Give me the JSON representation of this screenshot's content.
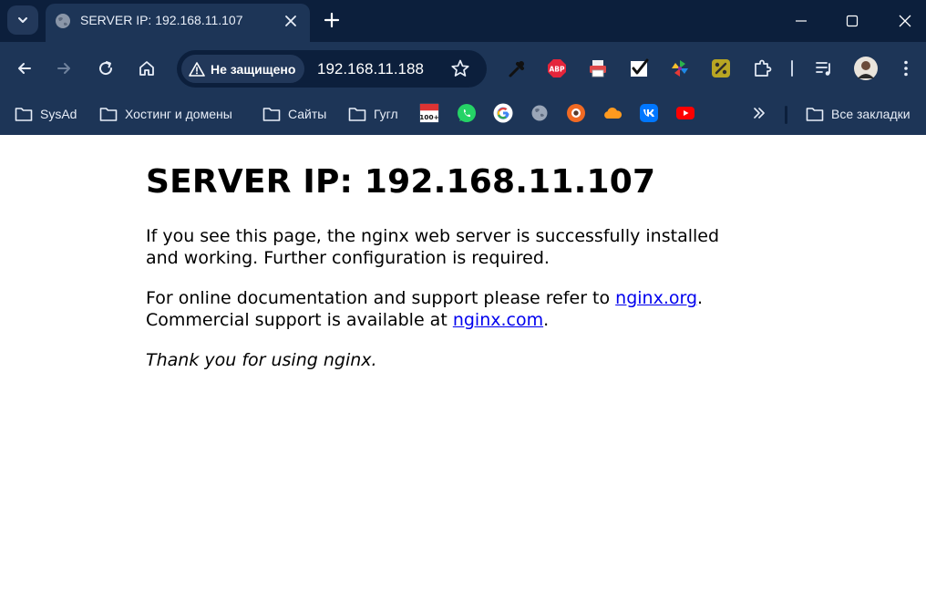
{
  "tab": {
    "title": "SERVER IP: 192.168.11.107"
  },
  "omnibox": {
    "security_label": "Не защищено",
    "url": "192.168.11.188"
  },
  "toolbar": {
    "extensions": [
      "eyedropper-icon",
      "adblock-plus-icon",
      "printer-icon",
      "checkbox-icon",
      "pinwheel-icon",
      "percent-icon",
      "extensions-puzzle-icon"
    ],
    "abp_label": "ABP"
  },
  "bookmarks": {
    "folders": [
      {
        "label": "SysAd"
      },
      {
        "label": "Хостинг и домены"
      },
      {
        "label": "Сайты"
      },
      {
        "label": "Гугл"
      }
    ],
    "counter_badge": "100+",
    "all_bookmarks_label": "Все закладки"
  },
  "page": {
    "heading": "SERVER IP: 192.168.11.107",
    "para1": "If you see this page, the nginx web server is successfully installed and working. Further configuration is required.",
    "para2_before": "For online documentation and support please refer to ",
    "link1": "nginx.org",
    "para2_mid": ".",
    "para2_line2": "Commercial support is available at ",
    "link2": "nginx.com",
    "para2_end": ".",
    "thanks": "Thank you for using nginx."
  },
  "colors": {
    "frame_dark": "#0c1f3c",
    "frame": "#1d3557",
    "link": "#0000ee"
  }
}
